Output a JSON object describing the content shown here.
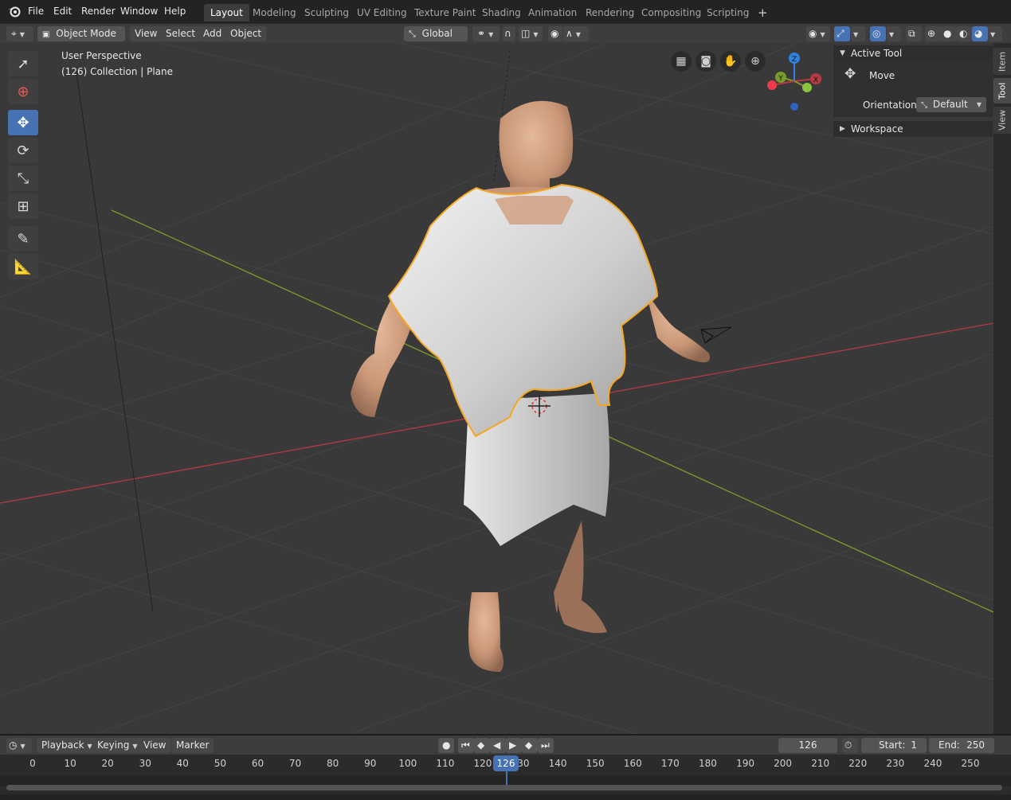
{
  "menu": {
    "items": [
      "File",
      "Edit",
      "Render",
      "Window",
      "Help"
    ]
  },
  "workspaces": {
    "tabs": [
      "Layout",
      "Modeling",
      "Sculpting",
      "UV Editing",
      "Texture Paint",
      "Shading",
      "Animation",
      "Rendering",
      "Compositing",
      "Scripting"
    ],
    "active": "Layout",
    "add_label": "+"
  },
  "header": {
    "mode": "Object Mode",
    "view": "View",
    "select": "Select",
    "add": "Add",
    "object": "Object",
    "orientation": "Global"
  },
  "viewport": {
    "perspective": "User Perspective",
    "collection": "(126) Collection | Plane",
    "gizmo": {
      "x": "X",
      "y": "Y",
      "z": "Z"
    }
  },
  "sidebar": {
    "active_tool_title": "Active Tool",
    "tool_name": "Move",
    "orientation_label": "Orientation",
    "orientation_value": "Default",
    "workspace_title": "Workspace",
    "tabs": [
      "Item",
      "Tool",
      "View"
    ],
    "active_tab": "Tool"
  },
  "timeline": {
    "playback": "Playback",
    "keying": "Keying",
    "view": "View",
    "marker": "Marker",
    "current_frame": "126",
    "start_label": "Start:",
    "start": "1",
    "end_label": "End:",
    "end": "250",
    "ticks": [
      "0",
      "10",
      "20",
      "30",
      "40",
      "50",
      "60",
      "70",
      "80",
      "90",
      "100",
      "110",
      "120",
      "130",
      "140",
      "150",
      "160",
      "170",
      "180",
      "190",
      "200",
      "210",
      "220",
      "230",
      "240",
      "250"
    ]
  },
  "colors": {
    "accent": "#4772b3",
    "selection_outline": "#f5a623",
    "x_axis": "#b53a44",
    "y_axis": "#7a9b2e",
    "z_axis": "#2f83e0"
  }
}
